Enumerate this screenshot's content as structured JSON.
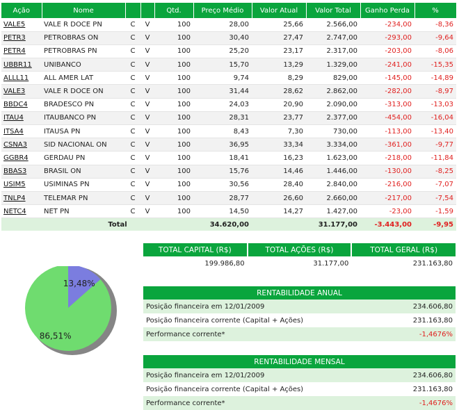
{
  "stocks": {
    "headers": [
      "Ação",
      "Nome",
      "",
      "",
      "Qtd.",
      "Preço Médio",
      "Valor Atual",
      "Valor Total",
      "Ganho Perda",
      "%"
    ],
    "rows": [
      {
        "ticker": "VALE5",
        "name": "VALE R DOCE PN",
        "c": "C",
        "v": "V",
        "qty": "100",
        "avg": "28,00",
        "cur": "25,66",
        "total": "2.566,00",
        "gain": "-234,00",
        "pct": "-8,36"
      },
      {
        "ticker": "PETR3",
        "name": "PETROBRAS ON",
        "c": "C",
        "v": "V",
        "qty": "100",
        "avg": "30,40",
        "cur": "27,47",
        "total": "2.747,00",
        "gain": "-293,00",
        "pct": "-9,64"
      },
      {
        "ticker": "PETR4",
        "name": "PETROBRAS PN",
        "c": "C",
        "v": "V",
        "qty": "100",
        "avg": "25,20",
        "cur": "23,17",
        "total": "2.317,00",
        "gain": "-203,00",
        "pct": "-8,06"
      },
      {
        "ticker": "UBBR11",
        "name": "UNIBANCO",
        "c": "C",
        "v": "V",
        "qty": "100",
        "avg": "15,70",
        "cur": "13,29",
        "total": "1.329,00",
        "gain": "-241,00",
        "pct": "-15,35"
      },
      {
        "ticker": "ALLL11",
        "name": "ALL AMER LAT",
        "c": "C",
        "v": "V",
        "qty": "100",
        "avg": "9,74",
        "cur": "8,29",
        "total": "829,00",
        "gain": "-145,00",
        "pct": "-14,89"
      },
      {
        "ticker": "VALE3",
        "name": "VALE R DOCE ON",
        "c": "C",
        "v": "V",
        "qty": "100",
        "avg": "31,44",
        "cur": "28,62",
        "total": "2.862,00",
        "gain": "-282,00",
        "pct": "-8,97"
      },
      {
        "ticker": "BBDC4",
        "name": "BRADESCO PN",
        "c": "C",
        "v": "V",
        "qty": "100",
        "avg": "24,03",
        "cur": "20,90",
        "total": "2.090,00",
        "gain": "-313,00",
        "pct": "-13,03"
      },
      {
        "ticker": "ITAU4",
        "name": "ITAUBANCO PN",
        "c": "C",
        "v": "V",
        "qty": "100",
        "avg": "28,31",
        "cur": "23,77",
        "total": "2.377,00",
        "gain": "-454,00",
        "pct": "-16,04"
      },
      {
        "ticker": "ITSA4",
        "name": "ITAUSA PN",
        "c": "C",
        "v": "V",
        "qty": "100",
        "avg": "8,43",
        "cur": "7,30",
        "total": "730,00",
        "gain": "-113,00",
        "pct": "-13,40"
      },
      {
        "ticker": "CSNA3",
        "name": "SID NACIONAL ON",
        "c": "C",
        "v": "V",
        "qty": "100",
        "avg": "36,95",
        "cur": "33,34",
        "total": "3.334,00",
        "gain": "-361,00",
        "pct": "-9,77"
      },
      {
        "ticker": "GGBR4",
        "name": "GERDAU PN",
        "c": "C",
        "v": "V",
        "qty": "100",
        "avg": "18,41",
        "cur": "16,23",
        "total": "1.623,00",
        "gain": "-218,00",
        "pct": "-11,84"
      },
      {
        "ticker": "BBAS3",
        "name": "BRASIL ON",
        "c": "C",
        "v": "V",
        "qty": "100",
        "avg": "15,76",
        "cur": "14,46",
        "total": "1.446,00",
        "gain": "-130,00",
        "pct": "-8,25"
      },
      {
        "ticker": "USIM5",
        "name": "USIMINAS PN",
        "c": "C",
        "v": "V",
        "qty": "100",
        "avg": "30,56",
        "cur": "28,40",
        "total": "2.840,00",
        "gain": "-216,00",
        "pct": "-7,07"
      },
      {
        "ticker": "TNLP4",
        "name": "TELEMAR PN",
        "c": "C",
        "v": "V",
        "qty": "100",
        "avg": "28,77",
        "cur": "26,60",
        "total": "2.660,00",
        "gain": "-217,00",
        "pct": "-7,54"
      },
      {
        "ticker": "NETC4",
        "name": "NET PN",
        "c": "C",
        "v": "V",
        "qty": "100",
        "avg": "14,50",
        "cur": "14,27",
        "total": "1.427,00",
        "gain": "-23,00",
        "pct": "-1,59"
      }
    ],
    "total": {
      "label": "Total",
      "avg": "34.620,00",
      "total": "31.177,00",
      "gain": "-3.443,00",
      "pct": "-9,95"
    }
  },
  "totals": {
    "headers": [
      "TOTAL CAPITAL (R$)",
      "TOTAL AÇÕES (R$)",
      "TOTAL GERAL (R$)"
    ],
    "values": [
      "199.986,80",
      "31.177,00",
      "231.163,80"
    ]
  },
  "annual": {
    "title": "RENTABILIDADE ANUAL",
    "rows": [
      {
        "label": "Posição financeira em 12/01/2009",
        "value": "234.606,80"
      },
      {
        "label": "Posição financeira corrente (Capital + Ações)",
        "value": "231.163,80"
      },
      {
        "label": "Performance corrente*",
        "value": "-1,4676%"
      }
    ]
  },
  "monthly": {
    "title": "RENTABILIDADE MENSAL",
    "rows": [
      {
        "label": "Posição financeira em 12/01/2009",
        "value": "234.606,80"
      },
      {
        "label": "Posição financeira corrente (Capital + Ações)",
        "value": "231.163,80"
      },
      {
        "label": "Performance corrente*",
        "value": "-1,4676%"
      }
    ]
  },
  "chart_data": {
    "type": "pie",
    "slices": [
      {
        "value": 86.51,
        "label": "86,51%",
        "color": "#6fdc6f"
      },
      {
        "value": 13.48,
        "label": "13,48%",
        "color": "#7b7ddf"
      }
    ]
  },
  "colors": {
    "header_green": "#0aa53d",
    "negative": "#e0201f",
    "light_green": "#ddf2dd"
  }
}
